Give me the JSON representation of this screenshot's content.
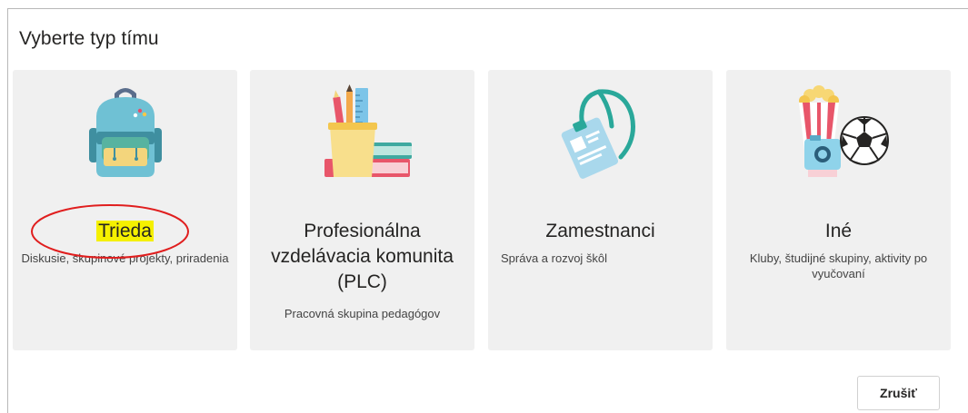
{
  "dialog": {
    "title": "Vyberte typ tímu",
    "cancel_label": "Zrušiť"
  },
  "cards": [
    {
      "name": "Trieda",
      "description": "Diskusie, skupinové projekty, priradenia",
      "icon": "backpack-icon"
    },
    {
      "name": "Profesionálna vzdelávacia komunita (PLC)",
      "description": "Pracovná skupina pedagógov",
      "icon": "books-pencils-icon"
    },
    {
      "name": "Zamestnanci",
      "description": "Správa a rozvoj škôl",
      "icon": "id-badge-lanyard-icon"
    },
    {
      "name": "Iné",
      "description": "Kluby, študijné skupiny, aktivity po vyučovaní",
      "icon": "popcorn-camera-ball-icon"
    }
  ],
  "annotation": {
    "color": "#e01e1e",
    "highlight": "#f5f000"
  }
}
